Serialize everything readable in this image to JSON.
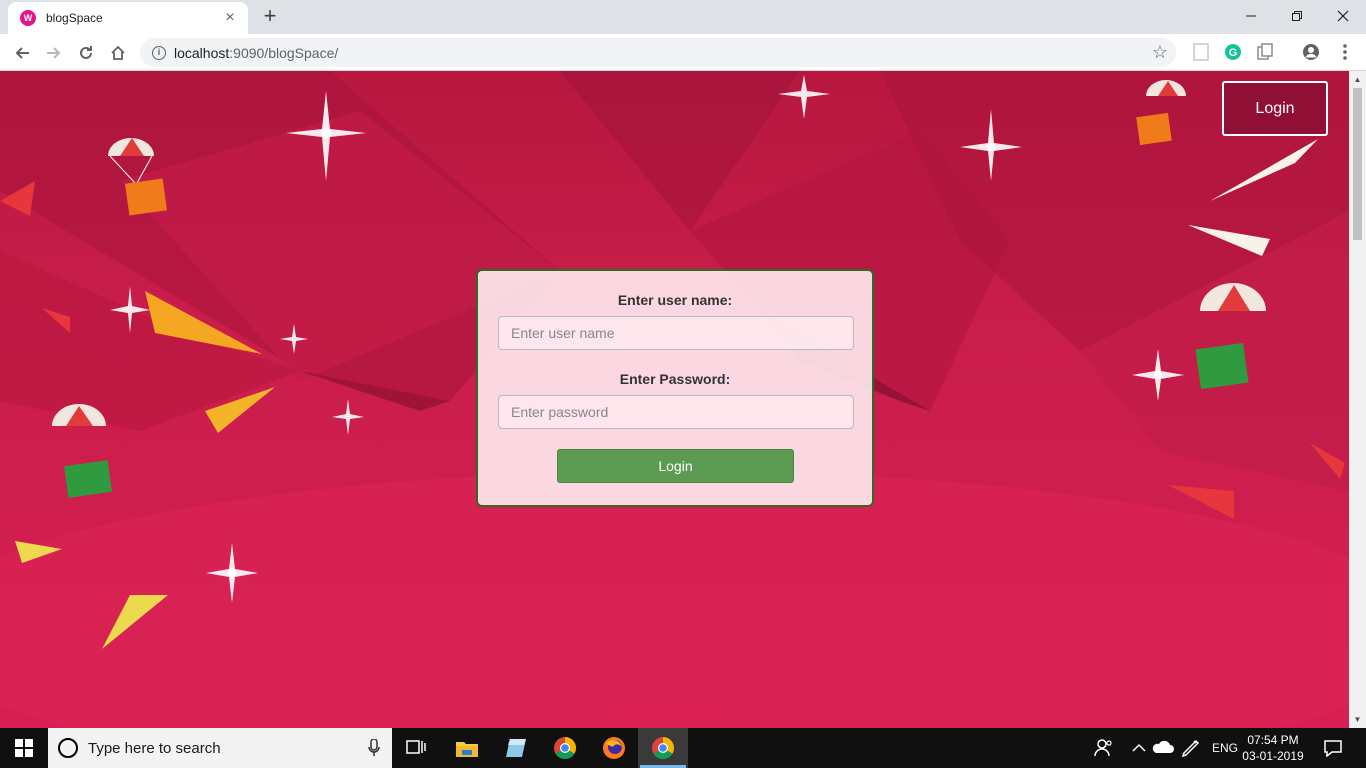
{
  "browser": {
    "tab_title": "blogSpace",
    "tab_close": "×",
    "new_tab": "+",
    "url_host": "localhost",
    "url_rest": ":9090/blogSpace/",
    "favicon_color": "#e0178a"
  },
  "header": {
    "login_label": "Login"
  },
  "login_form": {
    "username_label": "Enter user name:",
    "username_placeholder": "Enter user name",
    "username_value": "",
    "password_label": "Enter Password:",
    "password_placeholder": "Enter password",
    "password_value": "",
    "submit_label": "Login",
    "submit_color": "#5e9b52",
    "border_color": "#2f6b23"
  },
  "theme": {
    "background_primary": "#d61f52",
    "background_dark": "#b7173f",
    "header_button_bg": "#8f0f35"
  },
  "taskbar": {
    "search_placeholder": "Type here to search",
    "language": "ENG",
    "time": "07:54 PM",
    "date": "03-01-2019",
    "icons": [
      "windows-start-icon",
      "task-view-icon",
      "file-explorer-icon",
      "app-icon",
      "chrome-icon",
      "firefox-icon",
      "chrome-active-icon"
    ]
  }
}
